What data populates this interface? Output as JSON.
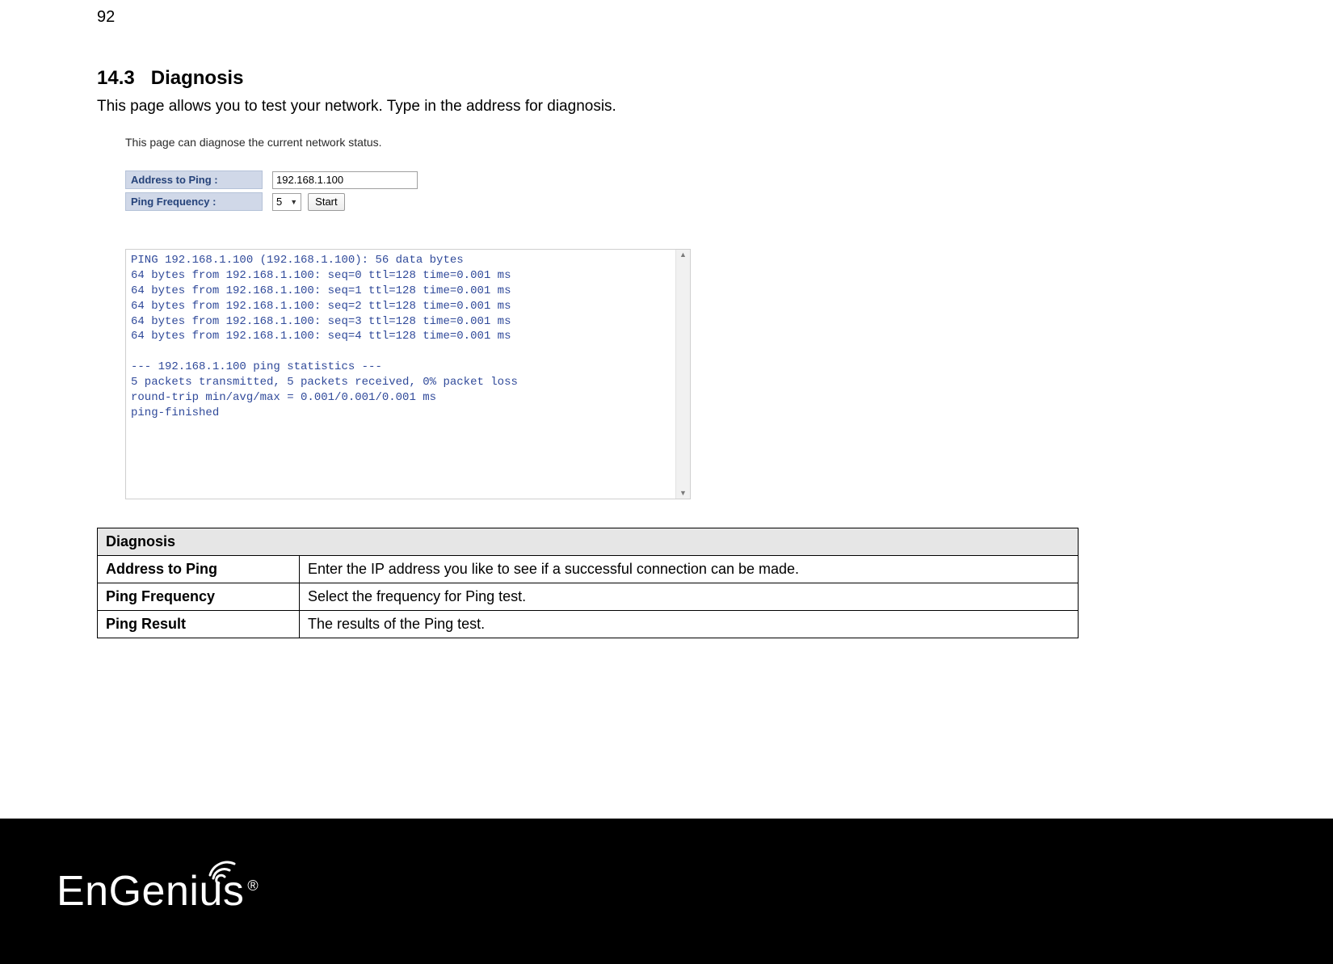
{
  "page_number": "92",
  "section": {
    "number": "14.3",
    "title": "Diagnosis",
    "intro": "This page allows you to test your network. Type in the address for diagnosis."
  },
  "screenshot": {
    "caption": "This page can diagnose the current network status.",
    "address_label": "Address to Ping :",
    "address_value": "192.168.1.100",
    "frequency_label": "Ping Frequency :",
    "frequency_value": "5",
    "start_button": "Start",
    "output": "PING 192.168.1.100 (192.168.1.100): 56 data bytes\n64 bytes from 192.168.1.100: seq=0 ttl=128 time=0.001 ms\n64 bytes from 192.168.1.100: seq=1 ttl=128 time=0.001 ms\n64 bytes from 192.168.1.100: seq=2 ttl=128 time=0.001 ms\n64 bytes from 192.168.1.100: seq=3 ttl=128 time=0.001 ms\n64 bytes from 192.168.1.100: seq=4 ttl=128 time=0.001 ms\n\n--- 192.168.1.100 ping statistics ---\n5 packets transmitted, 5 packets received, 0% packet loss\nround-trip min/avg/max = 0.001/0.001/0.001 ms\nping-finished"
  },
  "def_table": {
    "header": "Diagnosis",
    "rows": [
      {
        "key": "Address to Ping",
        "val": "Enter the IP address you like to see if a successful connection can be made."
      },
      {
        "key": "Ping Frequency",
        "val": "Select the frequency for Ping test."
      },
      {
        "key": "Ping Result",
        "val": "The results of the Ping test."
      }
    ]
  },
  "brand": {
    "name": "EnGenius",
    "reg": "®"
  }
}
